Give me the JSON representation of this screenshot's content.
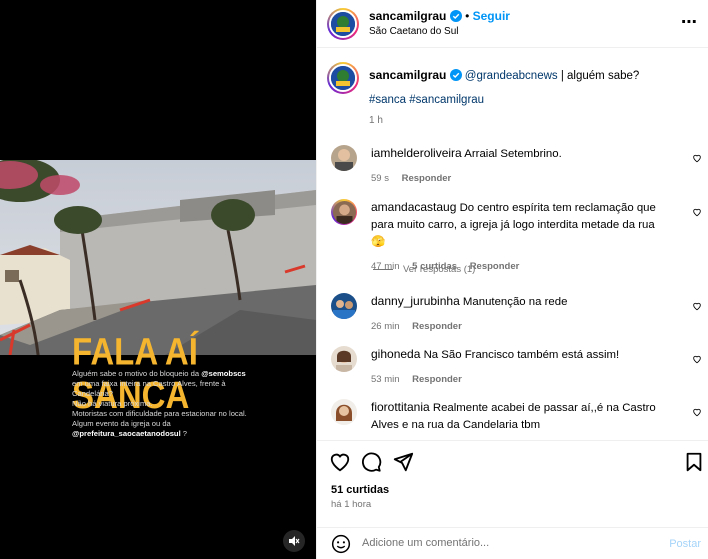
{
  "post": {
    "author": "sancamilgrau",
    "follow_label": "Seguir",
    "dot": "•",
    "location": "São Caetano do Sul",
    "more_label": "⋯"
  },
  "media": {
    "headline": "FALA AÍ SANCA",
    "overlay_lines": [
      {
        "pre": "Alguém sabe o motivo do bloqueio da ",
        "bold": "@semobscs"
      },
      {
        "pre": "em uma faixa inteira na Castro Alves, frente à",
        "bold": ""
      },
      {
        "pre": "Candelária?",
        "bold": ""
      },
      {
        "pre": "Não há viatura próxima.",
        "bold": ""
      },
      {
        "pre": "Motoristas com dificuldade para estacionar no local.",
        "bold": ""
      },
      {
        "pre": "Algum evento da igreja ou da",
        "bold": ""
      },
      {
        "pre": "",
        "bold": "@prefeitura_saocaetanodosul",
        "post": " ?"
      }
    ]
  },
  "caption": {
    "author": "sancamilgrau",
    "mention": "@grandeabcnews",
    "text": " | alguém sabe?",
    "hashtags": "#sanca #sancamilgrau",
    "time": "1 h"
  },
  "comments": [
    {
      "user": "iamhelderoliveira",
      "text": "Arraial Setembrino.",
      "time": "59 s",
      "likes": "",
      "reply": "Responder"
    },
    {
      "user": "amandacastaug",
      "text": "Do centro espírita tem reclamação que para muito carro, a igreja já logo interdita metade da rua 🫣",
      "time": "47 min",
      "likes": "5 curtidas",
      "reply": "Responder",
      "view_replies": "Ver respostas (1)"
    },
    {
      "user": "danny_jurubinha",
      "text": "Manutenção na rede",
      "time": "26 min",
      "likes": "",
      "reply": "Responder"
    },
    {
      "user": "gihoneda",
      "text": "Na São Francisco também está assim!",
      "time": "53 min",
      "likes": "",
      "reply": "Responder"
    },
    {
      "user": "fiorottitania",
      "text": "Realmente acabei de passar aí,,é na Castro Alves e na rua da Candelaria tbm",
      "time": "",
      "likes": "",
      "reply": ""
    }
  ],
  "footer": {
    "likes": "51 curtidas",
    "time": "há 1 hora",
    "comment_placeholder": "Adicione um comentário...",
    "post_label": "Postar"
  },
  "colors": {
    "accent": "#0095f6",
    "headline": "#f5b52e",
    "link": "#00376b"
  }
}
